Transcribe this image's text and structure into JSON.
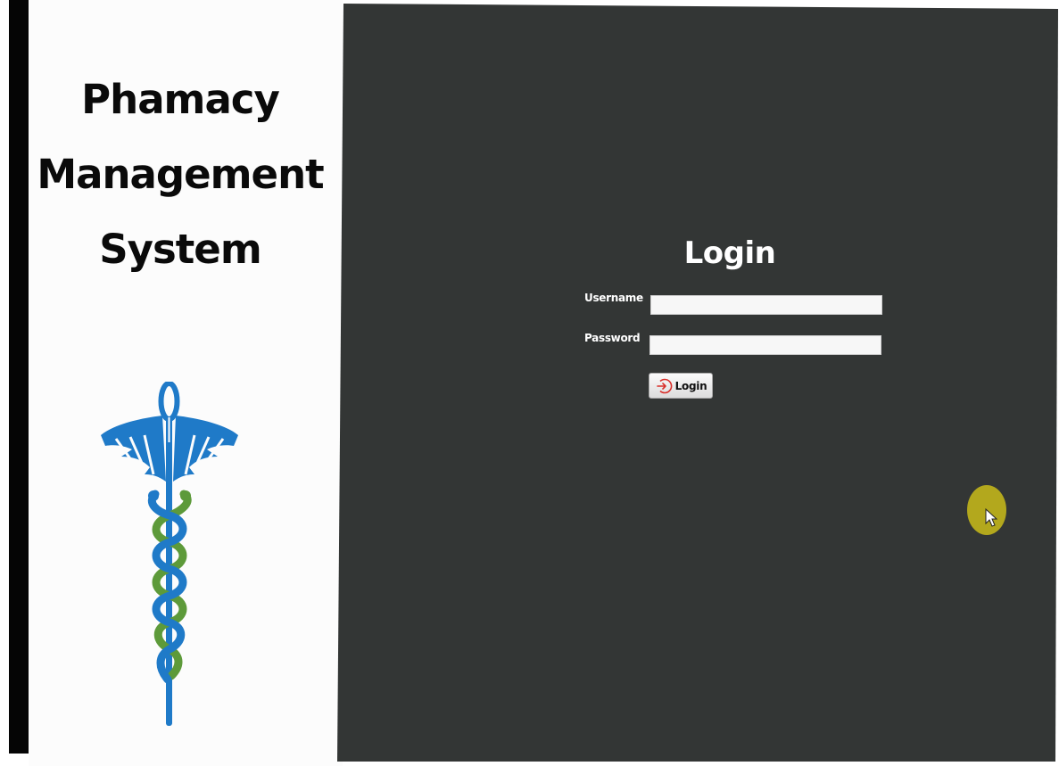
{
  "brand": {
    "title_lines": [
      "Phamacy",
      "Management",
      "System"
    ],
    "logo_icon": "caduceus-icon",
    "colors": {
      "blue": "#1f7ac8",
      "green": "#5d9a3a"
    }
  },
  "login": {
    "heading": "Login",
    "username_label": "Username",
    "username_value": "",
    "password_label": "Password",
    "password_value": "",
    "button_label": "Login",
    "button_icon": "login-arrow-icon"
  },
  "colors": {
    "panel_background": "#333635",
    "button_icon": "#d9302b",
    "cursor_highlight": "#b3a81d"
  }
}
